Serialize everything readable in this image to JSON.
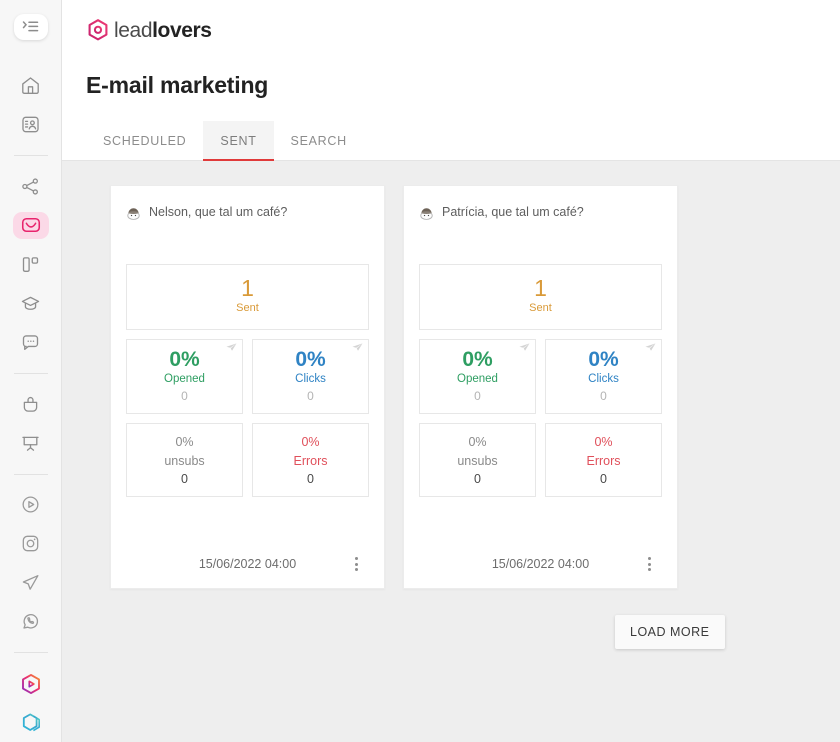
{
  "brand": {
    "logo_icon": "leadlovers-hexagon-logo-icon",
    "name_light": "lead",
    "name_bold": "lovers",
    "accent_pink": "#e8246d",
    "accent_red": "#e03a3a"
  },
  "sidebar": {
    "toggle": {
      "label": "",
      "icon": "menu-collapse-icon"
    },
    "groups": [
      {
        "items": [
          {
            "name": "home",
            "icon": "home-icon",
            "active": false
          },
          {
            "name": "contacts",
            "icon": "contact-card-icon",
            "active": false
          }
        ]
      },
      {
        "items": [
          {
            "name": "funnels",
            "icon": "share-nodes-icon",
            "active": false
          },
          {
            "name": "email-marketing",
            "icon": "mail-envelope-icon",
            "active": true
          },
          {
            "name": "pages",
            "icon": "columns-layout-icon",
            "active": false
          },
          {
            "name": "courses",
            "icon": "graduation-cap-icon",
            "active": false
          },
          {
            "name": "chat",
            "icon": "chat-bubble-icon",
            "active": false
          }
        ]
      },
      {
        "items": [
          {
            "name": "checkout",
            "icon": "shopping-bag-icon",
            "active": false
          },
          {
            "name": "webinars",
            "icon": "presentation-screen-icon",
            "active": false
          }
        ]
      },
      {
        "items": [
          {
            "name": "youtube",
            "icon": "play-circle-icon",
            "active": false
          },
          {
            "name": "instagram",
            "icon": "instagram-camera-icon",
            "active": false
          },
          {
            "name": "telegram",
            "icon": "telegram-paper-plane-icon",
            "active": false
          },
          {
            "name": "whatsapp",
            "icon": "whatsapp-icon",
            "active": false
          }
        ]
      },
      {
        "items": [
          {
            "name": "leadlovers-play",
            "icon": "hexagon-play-gradient-icon",
            "active": false
          },
          {
            "name": "leadlovers-apps",
            "icon": "hexagon-layers-gradient-icon",
            "active": false
          }
        ]
      }
    ]
  },
  "header": {
    "page_title": "E-mail marketing"
  },
  "tabs": [
    {
      "id": "scheduled",
      "label": "SCHEDULED",
      "active": false
    },
    {
      "id": "sent",
      "label": "SENT",
      "active": true
    },
    {
      "id": "search",
      "label": "SEARCH",
      "active": false
    }
  ],
  "cards": [
    {
      "avatar_icon": "user-avatar-icon",
      "title": "Nelson, que tal um café?",
      "sent": {
        "value": "1",
        "label": "Sent"
      },
      "opened": {
        "value": "0%",
        "label": "Opened",
        "count": "0",
        "icon": "paper-plane-icon"
      },
      "clicks": {
        "value": "0%",
        "label": "Clicks",
        "count": "0",
        "icon": "paper-plane-icon"
      },
      "unsubs": {
        "value": "0%",
        "label": "unsubs",
        "count": "0"
      },
      "errors": {
        "value": "0%",
        "label": "Errors",
        "count": "0"
      },
      "date": "15/06/2022 04:00",
      "menu_icon": "more-vertical-icon"
    },
    {
      "avatar_icon": "user-avatar-icon",
      "title": "Patrícia, que tal um café?",
      "sent": {
        "value": "1",
        "label": "Sent"
      },
      "opened": {
        "value": "0%",
        "label": "Opened",
        "count": "0",
        "icon": "paper-plane-icon"
      },
      "clicks": {
        "value": "0%",
        "label": "Clicks",
        "count": "0",
        "icon": "paper-plane-icon"
      },
      "unsubs": {
        "value": "0%",
        "label": "unsubs",
        "count": "0"
      },
      "errors": {
        "value": "0%",
        "label": "Errors",
        "count": "0"
      },
      "date": "15/06/2022 04:00",
      "menu_icon": "more-vertical-icon"
    }
  ],
  "footer": {
    "load_more_label": "LOAD MORE"
  },
  "colors": {
    "sent": "#d99a38",
    "opened": "#2e9e62",
    "clicks": "#2f83c4",
    "unsubs": "#8a8a8a",
    "errors": "#e0505b",
    "page_bg": "#eeeeee",
    "card_bg": "#ffffff"
  }
}
